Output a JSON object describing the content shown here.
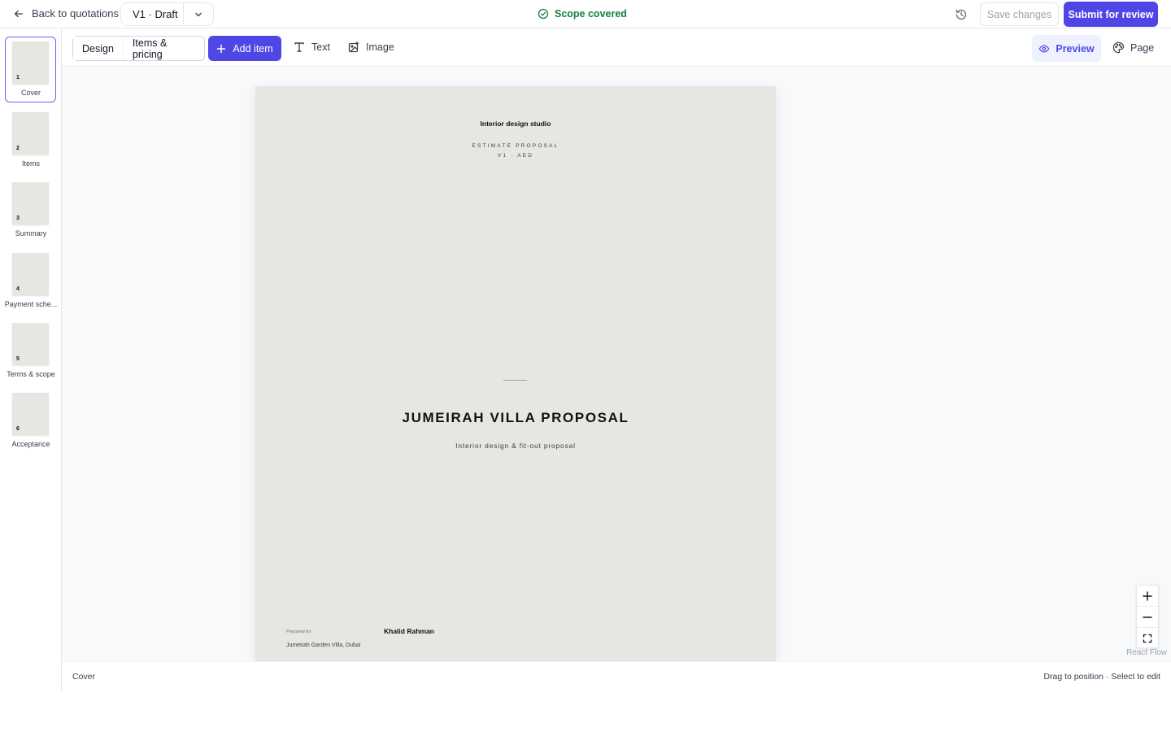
{
  "header": {
    "back_label": "Back to quotations",
    "version_label": "V1 · Draft",
    "scope_status": "Scope covered",
    "save_label": "Save changes",
    "submit_label": "Submit for review"
  },
  "toolbar": {
    "tabs": [
      {
        "label": "Design",
        "active": true
      },
      {
        "label": "Items & pricing",
        "active": false
      }
    ],
    "add_item_label": "Add item",
    "text_label": "Text",
    "image_label": "Image",
    "preview_label": "Preview",
    "page_label": "Page"
  },
  "pages": [
    {
      "num": "1",
      "label": "Cover",
      "active": true
    },
    {
      "num": "2",
      "label": "Items",
      "active": false
    },
    {
      "num": "3",
      "label": "Summary",
      "active": false
    },
    {
      "num": "4",
      "label": "Payment sche...",
      "active": false
    },
    {
      "num": "5",
      "label": "Terms & scope",
      "active": false
    },
    {
      "num": "6",
      "label": "Acceptance",
      "active": false
    }
  ],
  "document": {
    "studio": "Interior design studio",
    "estimate": "ESTIMATE PROPOSAL",
    "version": "V1 · AED",
    "title": "JUMEIRAH VILLA PROPOSAL",
    "subtitle": "Interior design & fit-out proposal",
    "prepared_label": "Prepared for",
    "client_name": "Khalid Rahman",
    "client_address": "Jumeirah Garden Villa, Dubai"
  },
  "canvas": {
    "attribution": "React Flow"
  },
  "status": {
    "current_page": "Cover",
    "hint": "Drag to position · Select to edit"
  },
  "colors": {
    "accent": "#4f46e5",
    "success": "#15803d",
    "page_bg": "#e7e6e2"
  }
}
